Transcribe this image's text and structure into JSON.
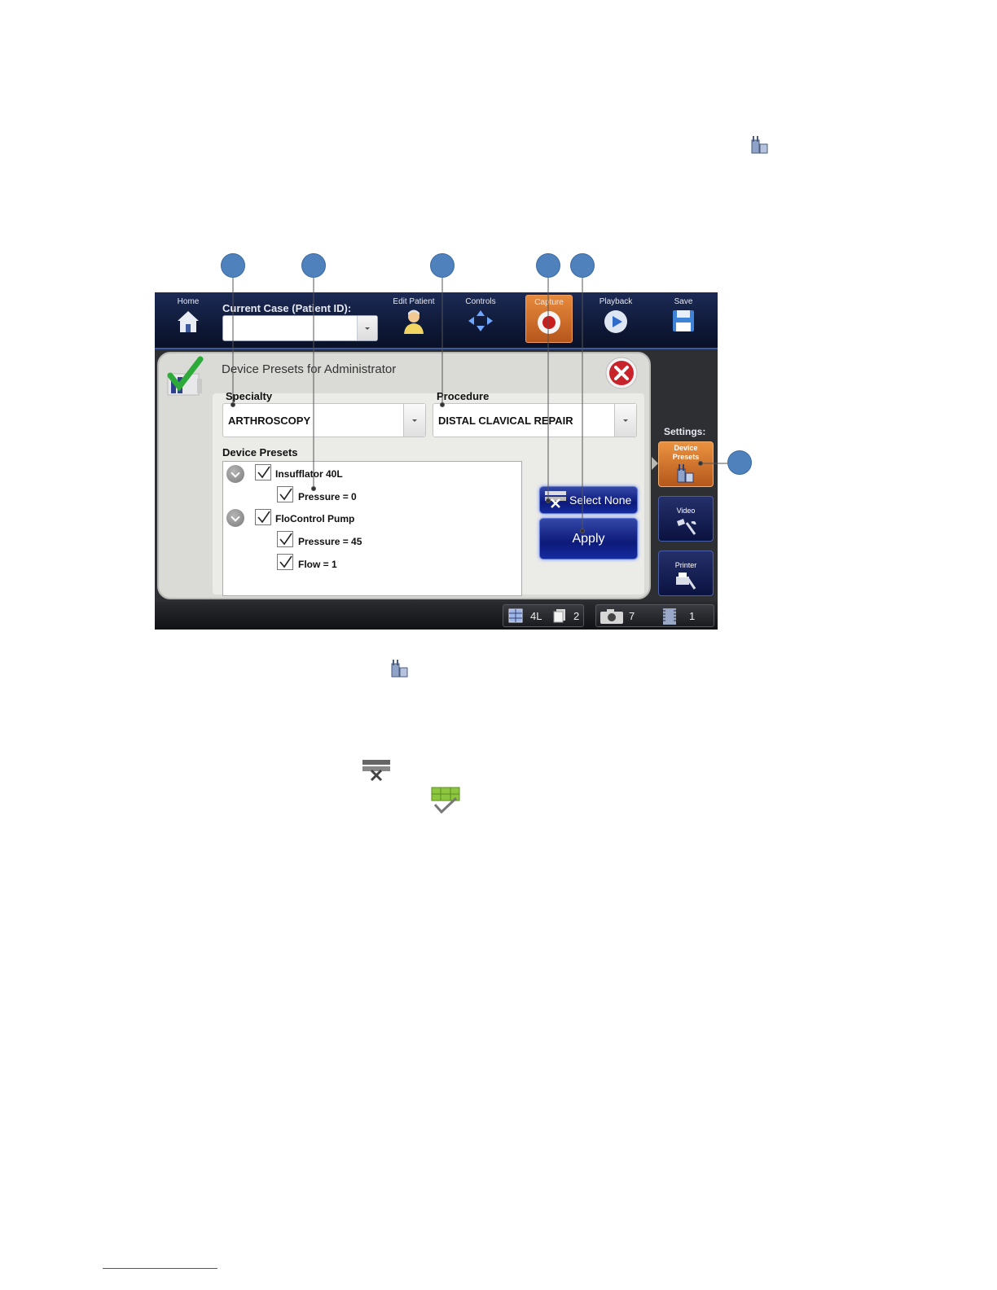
{
  "toolbar": {
    "home": "Home",
    "current_case_label": "Current Case (Patient ID):",
    "current_case_value": "",
    "edit_patient": "Edit Patient",
    "controls": "Controls",
    "capture": "Capture",
    "playback": "Playback",
    "save": "Save"
  },
  "dialog": {
    "title": "Device Presets for Administrator",
    "specialty_label": "Specialty",
    "specialty_value": "ARTHROSCOPY",
    "procedure_label": "Procedure",
    "procedure_value": "DISTAL CLAVICAL REPAIR",
    "device_presets_label": "Device Presets",
    "tree": [
      {
        "label": "Insufflator 40L",
        "checked": true,
        "children": [
          {
            "label": "Pressure = 0",
            "checked": true
          }
        ]
      },
      {
        "label": "FloControl Pump",
        "checked": true,
        "children": [
          {
            "label": "Pressure = 45",
            "checked": true
          },
          {
            "label": "Flow = 1",
            "checked": true
          }
        ]
      }
    ],
    "select_none": "Select None",
    "apply": "Apply"
  },
  "settings": {
    "label": "Settings:",
    "device_presets_line1": "Device",
    "device_presets_line2": "Presets",
    "video": "Video",
    "printer": "Printer"
  },
  "status": {
    "layout": "4L",
    "pages": "2",
    "photos": "7",
    "videos": "1"
  },
  "colors": {
    "toolbar_bg": "#0d1733",
    "accent_orange": "#d8762e",
    "button_blue": "#152b9f",
    "callout_blue": "#4f81bd"
  }
}
